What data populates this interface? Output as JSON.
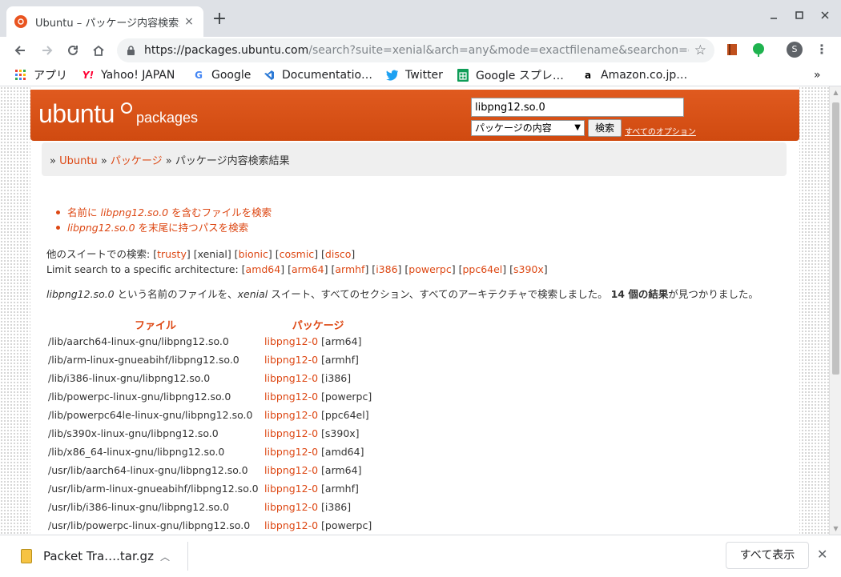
{
  "browser": {
    "tab_title": "Ubuntu – パッケージ内容検索結果",
    "tab_close": "×",
    "new_tab": "+",
    "url_host": "https://packages.ubuntu.com",
    "url_rest": "/search?suite=xenial&arch=any&mode=exactfilename&searchon=contents...",
    "avatar_letter": "S",
    "bookmarks": [
      {
        "label": "アプリ",
        "icon": "apps-grid-icon"
      },
      {
        "label": "Yahoo! JAPAN",
        "icon": "yahoo-icon"
      },
      {
        "label": "Google",
        "icon": "google-icon"
      },
      {
        "label": "Documentatio…",
        "icon": "vscode-icon"
      },
      {
        "label": "Twitter",
        "icon": "twitter-icon"
      },
      {
        "label": "Google スプレ…",
        "icon": "google-sheets-icon"
      },
      {
        "label": "Amazon.co.jp…",
        "icon": "amazon-icon"
      }
    ]
  },
  "site": {
    "logo_text": "ubuntu",
    "logo_sub": "packages",
    "search_value": "libpng12.so.0",
    "search_mode": "パッケージの内容",
    "search_button": "検索",
    "all_options": "すべてのオプション",
    "breadcrumb": {
      "prefix": "» ",
      "home": "Ubuntu",
      "sep1": " » ",
      "packages": "パッケージ",
      "sep2": " » ",
      "current": "パッケージ内容検索結果"
    }
  },
  "content": {
    "option1_prefix": "名前に ",
    "option1_em": "libpng12.so.0",
    "option1_suffix": " を含むファイルを検索",
    "option2_em": "libpng12.so.0",
    "option2_suffix": " を末尾に持つパスを検索",
    "suites_label": "他のスイートでの検索: ",
    "suites": [
      "trusty",
      "xenial",
      "bionic",
      "cosmic",
      "disco"
    ],
    "current_suite": "xenial",
    "arch_label": "Limit search to a specific architecture: ",
    "archs": [
      "amd64",
      "arm64",
      "armhf",
      "i386",
      "powerpc",
      "ppc64el",
      "s390x"
    ],
    "summary_em1": "libpng12.so.0",
    "summary_mid": " という名前のファイルを、",
    "summary_em2": "xenial",
    "summary_mid2": " スイート、すべてのセクション、すべてのアーキテクチャで検索しました。 ",
    "summary_bold": "14 個の結果",
    "summary_end": "が見つかりました。",
    "col_file": "ファイル",
    "col_package": "パッケージ",
    "rows": [
      {
        "path": "/lib/aarch64-linux-gnu/libpng12.so.0",
        "pkg": "libpng12-0",
        "arch": "[arm64]"
      },
      {
        "path": "/lib/arm-linux-gnueabihf/libpng12.so.0",
        "pkg": "libpng12-0",
        "arch": "[armhf]"
      },
      {
        "path": "/lib/i386-linux-gnu/libpng12.so.0",
        "pkg": "libpng12-0",
        "arch": "[i386]"
      },
      {
        "path": "/lib/powerpc-linux-gnu/libpng12.so.0",
        "pkg": "libpng12-0",
        "arch": "[powerpc]"
      },
      {
        "path": "/lib/powerpc64le-linux-gnu/libpng12.so.0",
        "pkg": "libpng12-0",
        "arch": "[ppc64el]"
      },
      {
        "path": "/lib/s390x-linux-gnu/libpng12.so.0",
        "pkg": "libpng12-0",
        "arch": "[s390x]"
      },
      {
        "path": "/lib/x86_64-linux-gnu/libpng12.so.0",
        "pkg": "libpng12-0",
        "arch": "[amd64]"
      },
      {
        "path": "/usr/lib/aarch64-linux-gnu/libpng12.so.0",
        "pkg": "libpng12-0",
        "arch": "[arm64]"
      },
      {
        "path": "/usr/lib/arm-linux-gnueabihf/libpng12.so.0",
        "pkg": "libpng12-0",
        "arch": "[armhf]"
      },
      {
        "path": "/usr/lib/i386-linux-gnu/libpng12.so.0",
        "pkg": "libpng12-0",
        "arch": "[i386]"
      },
      {
        "path": "/usr/lib/powerpc-linux-gnu/libpng12.so.0",
        "pkg": "libpng12-0",
        "arch": "[powerpc]"
      }
    ]
  },
  "download_shelf": {
    "file_name": "Packet Tra….tar.gz",
    "show_all": "すべて表示"
  },
  "colors": {
    "ubuntu_orange": "#dd4814",
    "chrome_tabstrip": "#dee1e6"
  }
}
